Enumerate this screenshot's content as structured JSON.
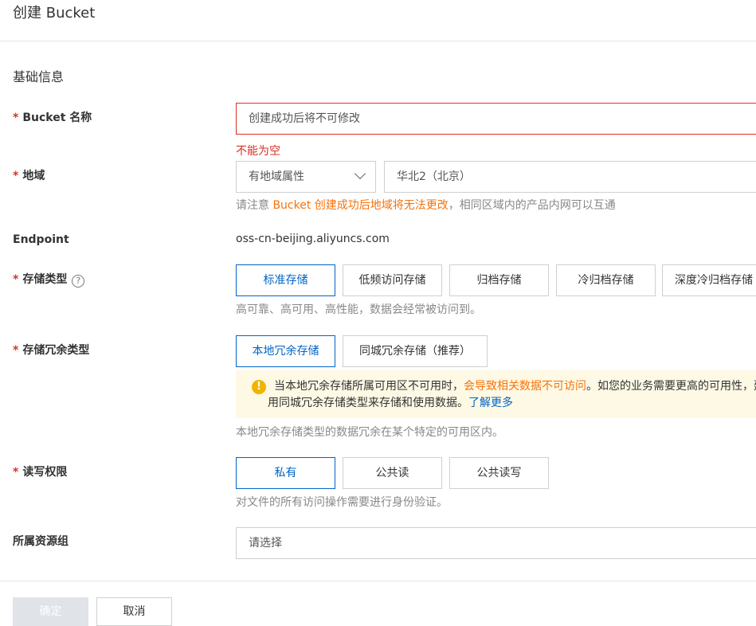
{
  "header": {
    "title": "创建 Bucket"
  },
  "section": {
    "title": "基础信息"
  },
  "required_mark": "*",
  "bucket_name": {
    "label": "Bucket 名称",
    "placeholder": "创建成功后将不可修改",
    "error": "不能为空"
  },
  "region": {
    "label": "地域",
    "type_value": "有地域属性",
    "region_value": "华北2（北京）",
    "hint_prefix": "请注意 ",
    "hint_warn": "Bucket 创建成功后地域将无法更改",
    "hint_suffix": "，相同区域内的产品内网可以互通"
  },
  "endpoint": {
    "label": "Endpoint",
    "value": "oss-cn-beijing.aliyuncs.com"
  },
  "storage_class": {
    "label": "存储类型",
    "help_icon": "?",
    "options": [
      "标准存储",
      "低频访问存储",
      "归档存储",
      "冷归档存储",
      "深度冷归档存储"
    ],
    "hint": "高可靠、高可用、高性能，数据会经常被访问到。"
  },
  "redundancy": {
    "label": "存储冗余类型",
    "options": [
      "本地冗余存储",
      "同城冗余存储（推荐）"
    ],
    "alert_icon": "!",
    "alert_part1": "当本地冗余存储所属可用区不可用时，",
    "alert_warn": "会导致相关数据不可访问",
    "alert_part2": "。如您的业务需要更高的可用性，建议使",
    "alert_line2": "用同城冗余存储类型来存储和使用数据。",
    "alert_link": "了解更多",
    "hint": "本地冗余存储类型的数据冗余在某个特定的可用区内。"
  },
  "acl": {
    "label": "读写权限",
    "options": [
      "私有",
      "公共读",
      "公共读写"
    ],
    "hint": "对文件的所有访问操作需要进行身份验证。"
  },
  "resource_group": {
    "label": "所属资源组",
    "placeholder": "请选择"
  },
  "footer": {
    "ok_label": "确定",
    "cancel_label": "取消"
  },
  "colors": {
    "primary": "#0064c8",
    "error": "#d93026",
    "warning": "#f7720b",
    "alert_bg": "#fef9e5"
  }
}
